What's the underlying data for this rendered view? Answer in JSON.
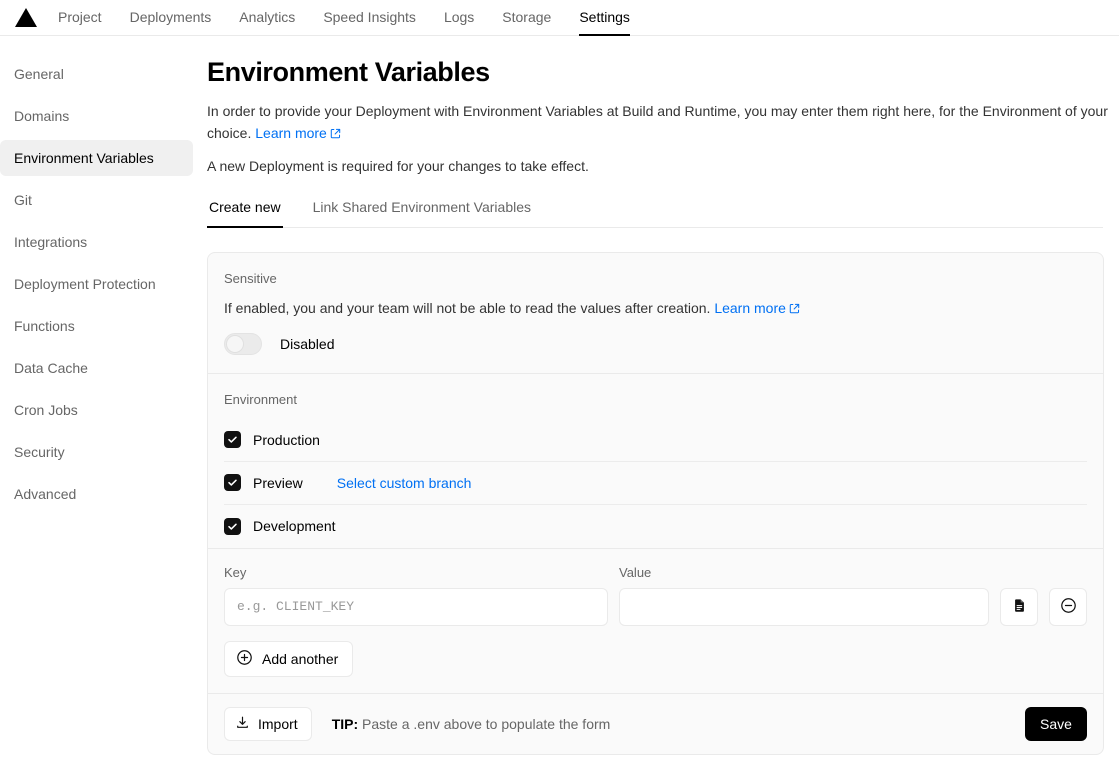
{
  "nav": {
    "logo_icon": "vercel-triangle-logo",
    "items": [
      {
        "label": "Project",
        "active": false
      },
      {
        "label": "Deployments",
        "active": false
      },
      {
        "label": "Analytics",
        "active": false
      },
      {
        "label": "Speed Insights",
        "active": false
      },
      {
        "label": "Logs",
        "active": false
      },
      {
        "label": "Storage",
        "active": false
      },
      {
        "label": "Settings",
        "active": true
      }
    ]
  },
  "sidebar": {
    "items": [
      {
        "label": "General",
        "active": false
      },
      {
        "label": "Domains",
        "active": false
      },
      {
        "label": "Environment Variables",
        "active": true
      },
      {
        "label": "Git",
        "active": false
      },
      {
        "label": "Integrations",
        "active": false
      },
      {
        "label": "Deployment Protection",
        "active": false
      },
      {
        "label": "Functions",
        "active": false
      },
      {
        "label": "Data Cache",
        "active": false
      },
      {
        "label": "Cron Jobs",
        "active": false
      },
      {
        "label": "Security",
        "active": false
      },
      {
        "label": "Advanced",
        "active": false
      }
    ]
  },
  "header": {
    "title": "Environment Variables",
    "description": "In order to provide your Deployment with Environment Variables at Build and Runtime, you may enter them right here, for the Environment of your choice.",
    "learn_more": "Learn more",
    "note": "A new Deployment is required for your changes to take effect."
  },
  "tabs": [
    {
      "label": "Create new",
      "active": true
    },
    {
      "label": "Link Shared Environment Variables",
      "active": false
    }
  ],
  "sensitive": {
    "label": "Sensitive",
    "description": "If enabled, you and your team will not be able to read the values after creation.",
    "learn_more": "Learn more",
    "toggle_state": "Disabled",
    "toggle_on": false
  },
  "environment": {
    "label": "Environment",
    "options": [
      {
        "label": "Production",
        "checked": true
      },
      {
        "label": "Preview",
        "checked": true
      },
      {
        "label": "Development",
        "checked": true
      }
    ],
    "branch_link": "Select custom branch"
  },
  "keyvalue": {
    "key_label": "Key",
    "value_label": "Value",
    "key_placeholder": "e.g. CLIENT_KEY",
    "key_value": "",
    "value_placeholder": "",
    "value_value": "",
    "document_icon": "document-icon",
    "remove_icon": "circle-minus-icon",
    "add_another": "Add another",
    "add_icon": "circle-plus-icon"
  },
  "footer": {
    "import_label": "Import",
    "import_icon": "download-icon",
    "tip_prefix": "TIP:",
    "tip_text": "Paste a .env above to populate the form",
    "save_label": "Save"
  },
  "colors": {
    "accent_link": "#0070f3",
    "primary": "#000000",
    "card_bg": "#fafafa",
    "border": "#eaeaea"
  }
}
